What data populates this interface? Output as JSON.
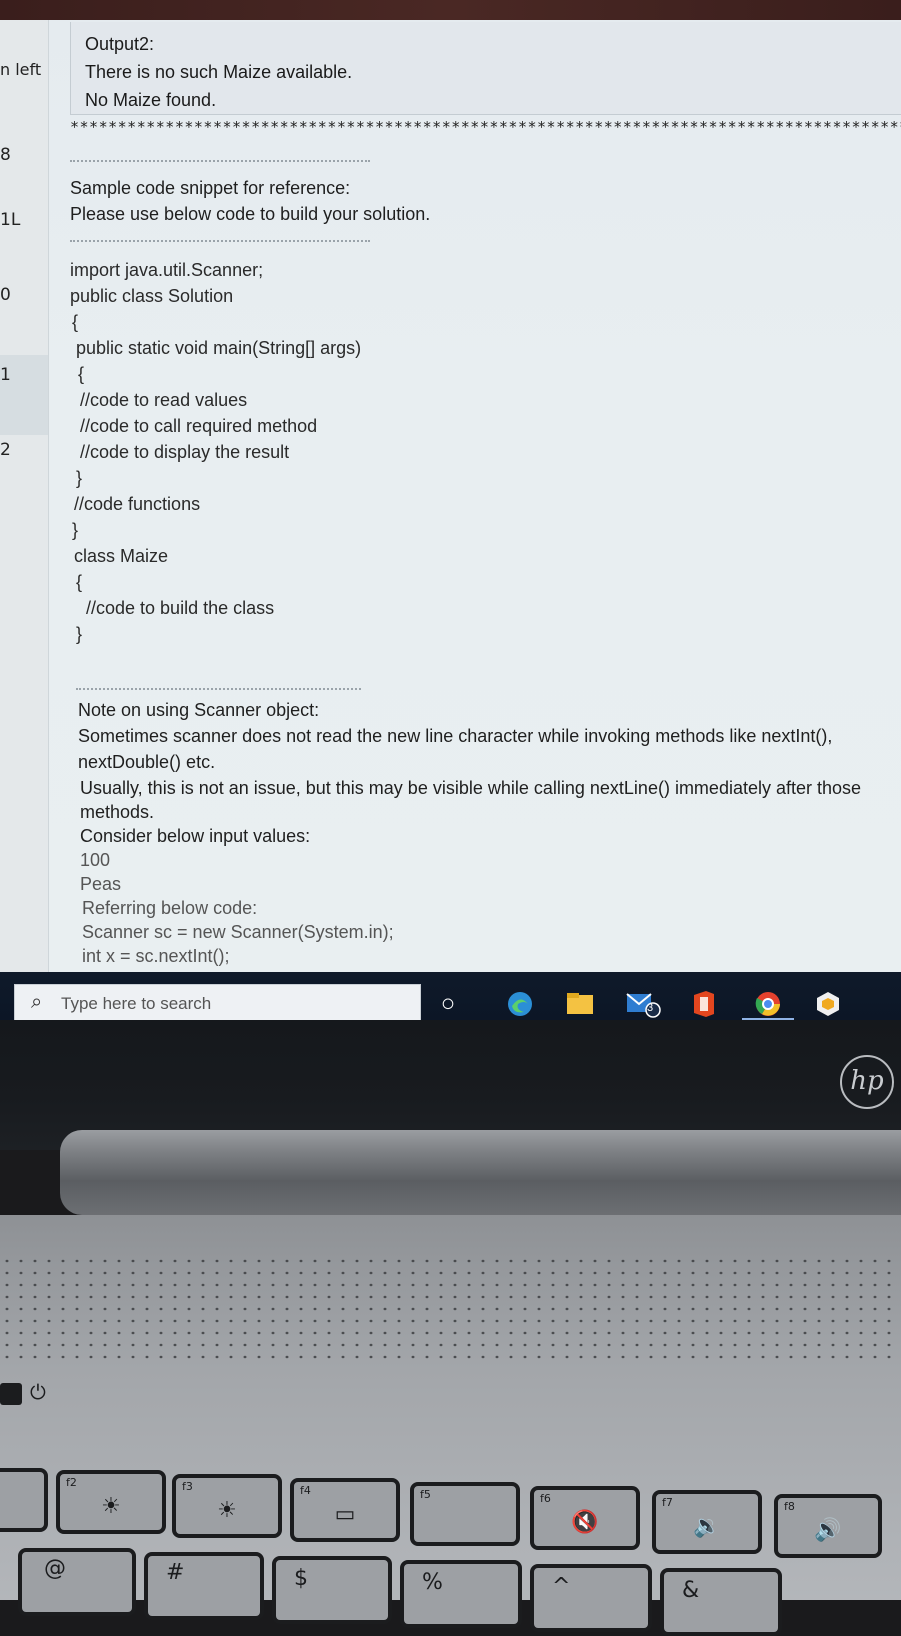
{
  "left_panel": {
    "header": "n left",
    "items": [
      "8",
      "1L",
      "0",
      "1",
      "2"
    ]
  },
  "output_box": {
    "title": "Output2:",
    "line1": "There is no such Maize available.",
    "line2": "No Maize found."
  },
  "stars": "*****************************************************************************************************",
  "snippet": {
    "title": "Sample code snippet for reference:",
    "instruction": "Please use below code to build your solution."
  },
  "code": [
    "import java.util.Scanner;",
    "public class Solution",
    "{",
    "public static void main(String[] args)",
    "{",
    "//code to read values",
    "//code to call required method",
    "//code to display the result",
    "}",
    "//code functions",
    "}",
    "class Maize",
    "{",
    "//code to build the class",
    "}"
  ],
  "note": {
    "title": "Note on using Scanner object:",
    "l1": "Sometimes scanner does not read the new line character while invoking methods like nextInt(),",
    "l2": "nextDouble() etc.",
    "l3": "Usually, this is not an issue, but this may be visible while calling nextLine() immediately after those",
    "l4": "methods.",
    "l5": "Consider below input values:",
    "l6": "100",
    "l7": "Peas",
    "l8": "Referring below code:",
    "l9": "Scanner sc = new Scanner(System.in);",
    "l10": "int x = sc.nextInt();"
  },
  "taskbar": {
    "search_placeholder": "Type here to search",
    "mail_badge": "3",
    "icons": [
      "search-icon",
      "cortana-circle-icon",
      "edge-icon",
      "file-explorer-icon",
      "mail-icon",
      "office-icon",
      "chrome-icon",
      "app-shield-icon"
    ]
  },
  "laptop": {
    "logo": "hp",
    "keys": [
      {
        "fn": "f2",
        "sym": "☀"
      },
      {
        "fn": "f3",
        "sym": "☀"
      },
      {
        "fn": "f4",
        "sym": "▭"
      },
      {
        "fn": "f5",
        "sym": ""
      },
      {
        "fn": "f6",
        "sym": "🔇"
      },
      {
        "fn": "f7",
        "sym": "🔉"
      },
      {
        "fn": "f8",
        "sym": "🔊"
      }
    ],
    "num_keys": [
      "@",
      "#",
      "$",
      "%",
      "^",
      "&"
    ]
  }
}
